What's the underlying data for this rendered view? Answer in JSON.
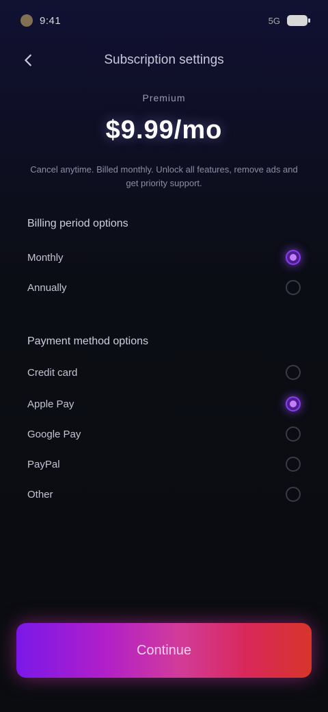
{
  "status_bar": {
    "time": "9:41",
    "network": "5G"
  },
  "nav": {
    "back_icon": "chevron-left-icon",
    "title": "Subscription settings"
  },
  "plan": {
    "subtitle": "Premium",
    "price": "$9.99/mo",
    "description": "Cancel anytime. Billed monthly. Unlock all features, remove ads and get priority support."
  },
  "billing": {
    "title": "Billing period options",
    "options": [
      {
        "label": "Monthly",
        "selected": true
      },
      {
        "label": "Annually",
        "selected": false
      }
    ]
  },
  "payment": {
    "title": "Payment method options",
    "options": [
      {
        "label": "Credit card",
        "selected": false
      },
      {
        "label": "Apple Pay",
        "selected": true
      },
      {
        "label": "Google Pay",
        "selected": false
      },
      {
        "label": "PayPal",
        "selected": false
      },
      {
        "label": "Other",
        "selected": false
      }
    ]
  },
  "cta": {
    "label": "Continue"
  },
  "colors": {
    "accent": "#8a3cf0",
    "cta_start": "#7a18e8",
    "cta_end": "#d8352a"
  }
}
